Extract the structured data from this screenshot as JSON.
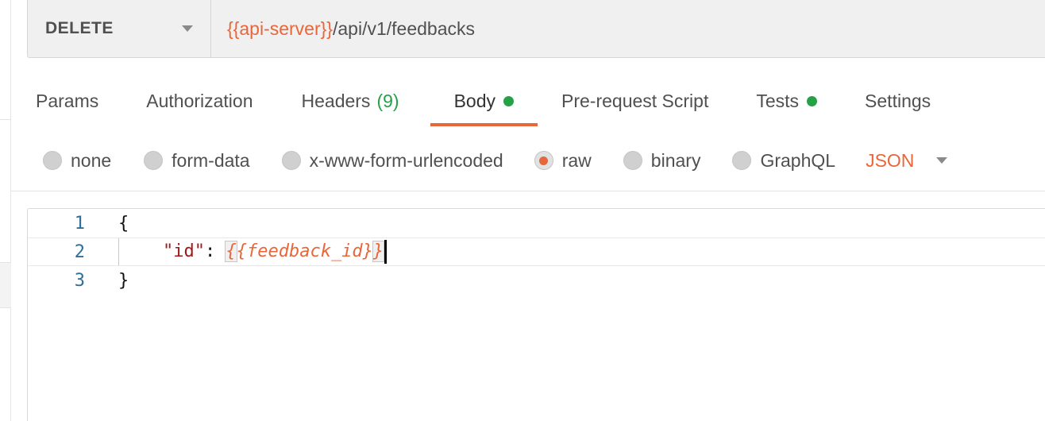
{
  "request": {
    "method": "DELETE",
    "url_variable": "{{api-server}}",
    "url_path": "/api/v1/feedbacks"
  },
  "tabs": [
    {
      "label": "Params"
    },
    {
      "label": "Authorization"
    },
    {
      "label": "Headers",
      "count": "(9)"
    },
    {
      "label": "Body",
      "active": true,
      "indicator": true
    },
    {
      "label": "Pre-request Script"
    },
    {
      "label": "Tests",
      "indicator": true
    },
    {
      "label": "Settings"
    }
  ],
  "body_types": [
    {
      "label": "none"
    },
    {
      "label": "form-data"
    },
    {
      "label": "x-www-form-urlencoded"
    },
    {
      "label": "raw",
      "selected": true
    },
    {
      "label": "binary"
    },
    {
      "label": "GraphQL"
    }
  ],
  "format": "JSON",
  "editor": {
    "lines": [
      {
        "number": "1",
        "open": "{"
      },
      {
        "number": "2",
        "key": "\"id\"",
        "sep": ": ",
        "brace_open": "{",
        "value": "{feedback_id}",
        "brace_close": "}"
      },
      {
        "number": "3",
        "close": "}"
      }
    ]
  },
  "colors": {
    "accent": "#e8673a",
    "active_dot": "#26a147",
    "json_key": "#a01919",
    "line_number": "#2f6f96"
  }
}
